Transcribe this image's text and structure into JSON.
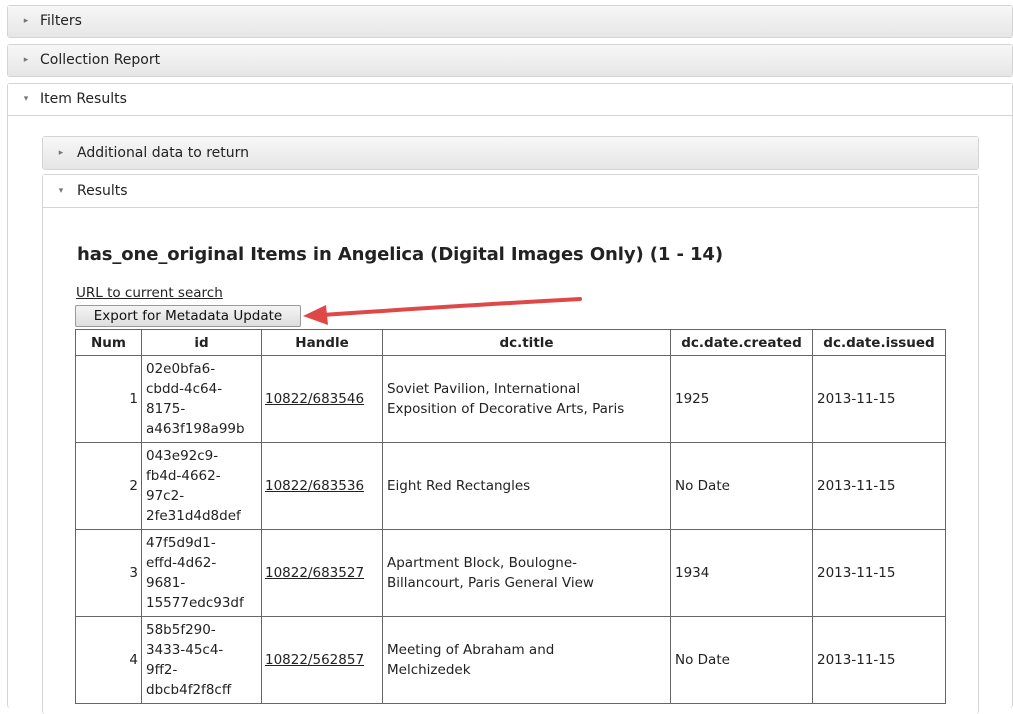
{
  "sections": {
    "filters": {
      "label": "Filters"
    },
    "collection_report": {
      "label": "Collection Report"
    },
    "item_results": {
      "label": "Item Results"
    },
    "additional_data": {
      "label": "Additional data to return"
    },
    "results": {
      "label": "Results"
    }
  },
  "results": {
    "heading": "has_one_original Items in Angelica (Digital Images Only) (1 - 14)",
    "url_link": "URL to current search",
    "export_button": "Export for Metadata Update"
  },
  "table": {
    "columns": [
      "Num",
      "id",
      "Handle",
      "dc.title",
      "dc.date.created",
      "dc.date.issued"
    ],
    "rows": [
      {
        "num": "1",
        "id_lines": [
          "02e0bfa6-",
          "cbdd-4c64-",
          "8175-",
          "a463f198a99b"
        ],
        "handle": "10822/683546",
        "title_lines": [
          "Soviet Pavilion, International",
          "Exposition of Decorative Arts, Paris"
        ],
        "created": "1925",
        "issued": "2013-11-15"
      },
      {
        "num": "2",
        "id_lines": [
          "043e92c9-",
          "fb4d-4662-",
          "97c2-",
          "2fe31d4d8def"
        ],
        "handle": "10822/683536",
        "title_lines": [
          "Eight Red Rectangles"
        ],
        "created": "No Date",
        "issued": "2013-11-15"
      },
      {
        "num": "3",
        "id_lines": [
          "47f5d9d1-",
          "effd-4d62-",
          "9681-",
          "15577edc93df"
        ],
        "handle": "10822/683527",
        "title_lines": [
          "Apartment Block, Boulogne-",
          "Billancourt, Paris General View"
        ],
        "created": "1934",
        "issued": "2013-11-15"
      },
      {
        "num": "4",
        "id_lines": [
          "58b5f290-",
          "3433-45c4-",
          "9ff2-",
          "dbcb4f2f8cff"
        ],
        "handle": "10822/562857",
        "title_lines": [
          "Meeting of Abraham and",
          "Melchizedek"
        ],
        "created": "No Date",
        "issued": "2013-11-15"
      }
    ]
  },
  "annotation": {
    "arrow_color": "#e04848"
  }
}
